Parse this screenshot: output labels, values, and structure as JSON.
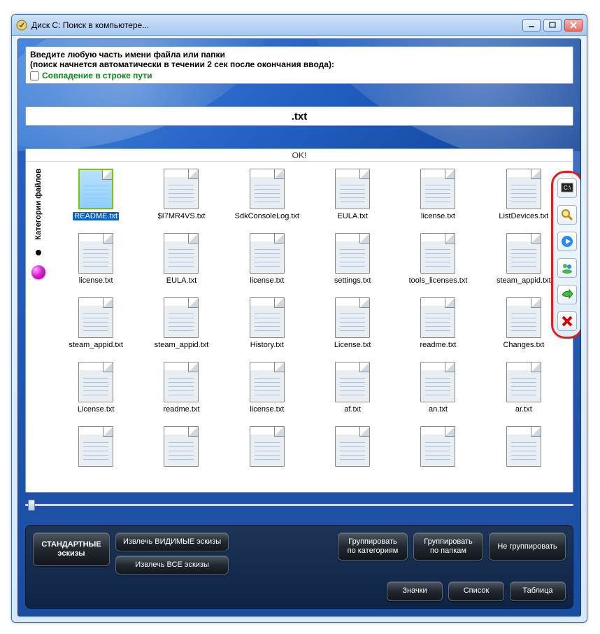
{
  "window": {
    "title": "Диск С: Поиск в компьютере..."
  },
  "search": {
    "hint1": "Введите любую часть имени файла или папки",
    "hint2": "(поиск начнется автоматически в течении 2 сек после окончания ввода):",
    "checkbox_label": "Совпадение в строке пути",
    "query": ".txt"
  },
  "status": "OK!",
  "sidebar": {
    "tab_label": "Категории файлов"
  },
  "files": [
    {
      "name": "README.txt",
      "selected": true
    },
    {
      "name": "$I7MR4VS.txt"
    },
    {
      "name": "SdkConsoleLog.txt"
    },
    {
      "name": "EULA.txt"
    },
    {
      "name": "license.txt"
    },
    {
      "name": "ListDevices.txt"
    },
    {
      "name": "license.txt"
    },
    {
      "name": "EULA.txt"
    },
    {
      "name": "license.txt"
    },
    {
      "name": "settings.txt"
    },
    {
      "name": "tools_licenses.txt"
    },
    {
      "name": "steam_appid.txt"
    },
    {
      "name": "steam_appid.txt"
    },
    {
      "name": "steam_appid.txt"
    },
    {
      "name": "History.txt"
    },
    {
      "name": "License.txt"
    },
    {
      "name": "readme.txt"
    },
    {
      "name": "Changes.txt"
    },
    {
      "name": "License.txt"
    },
    {
      "name": "readme.txt"
    },
    {
      "name": "license.txt"
    },
    {
      "name": "af.txt"
    },
    {
      "name": "an.txt"
    },
    {
      "name": "ar.txt"
    },
    {
      "name": ""
    },
    {
      "name": ""
    },
    {
      "name": ""
    },
    {
      "name": ""
    },
    {
      "name": ""
    },
    {
      "name": ""
    }
  ],
  "buttons": {
    "standard_thumbs": "СТАНДАРТНЫЕ\nэскизы",
    "extract_visible": "Извлечь ВИДИМЫЕ эскизы",
    "extract_all": "Извлечь ВСЕ эскизы",
    "group_by_categories": "Группировать\nпо категориям",
    "group_by_folders": "Группировать\nпо папкам",
    "no_group": "Не группировать",
    "icons": "Значки",
    "list": "Список",
    "table": "Таблица"
  }
}
